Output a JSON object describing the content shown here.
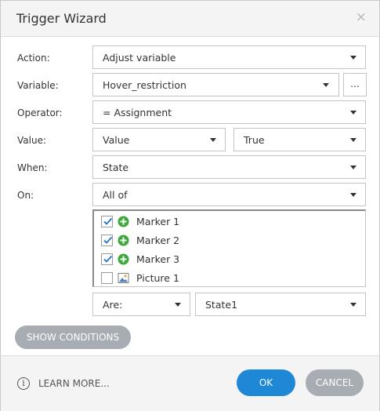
{
  "dialog": {
    "title": "Trigger Wizard",
    "close_glyph": "×"
  },
  "form": {
    "action": {
      "label": "Action:",
      "value": "Adjust variable"
    },
    "variable": {
      "label": "Variable:",
      "value": "Hover_restriction",
      "more_label": "..."
    },
    "operator": {
      "label": "Operator:",
      "value": "= Assignment"
    },
    "value": {
      "label": "Value:",
      "type": "Value",
      "value": "True"
    },
    "when": {
      "label": "When:",
      "value": "State"
    },
    "on": {
      "label": "On:",
      "value": "All of"
    }
  },
  "objects": [
    {
      "label": "Marker 1",
      "checked": true,
      "icon": "green-plus-marker-icon"
    },
    {
      "label": "Marker 2",
      "checked": true,
      "icon": "green-plus-marker-icon"
    },
    {
      "label": "Marker 3",
      "checked": true,
      "icon": "green-plus-marker-icon"
    },
    {
      "label": "Picture 1",
      "checked": false,
      "icon": "picture-icon"
    }
  ],
  "state_filter": {
    "are": "Are:",
    "state": "State1"
  },
  "buttons": {
    "show_conditions": "SHOW CONDITIONS",
    "learn_more": "LEARN MORE...",
    "ok": "OK",
    "cancel": "CANCEL"
  },
  "colors": {
    "primary": "#1e88d6",
    "secondary": "#a7adb3",
    "checkmark": "#1a73c9",
    "plus_green": "#3ea83a"
  }
}
